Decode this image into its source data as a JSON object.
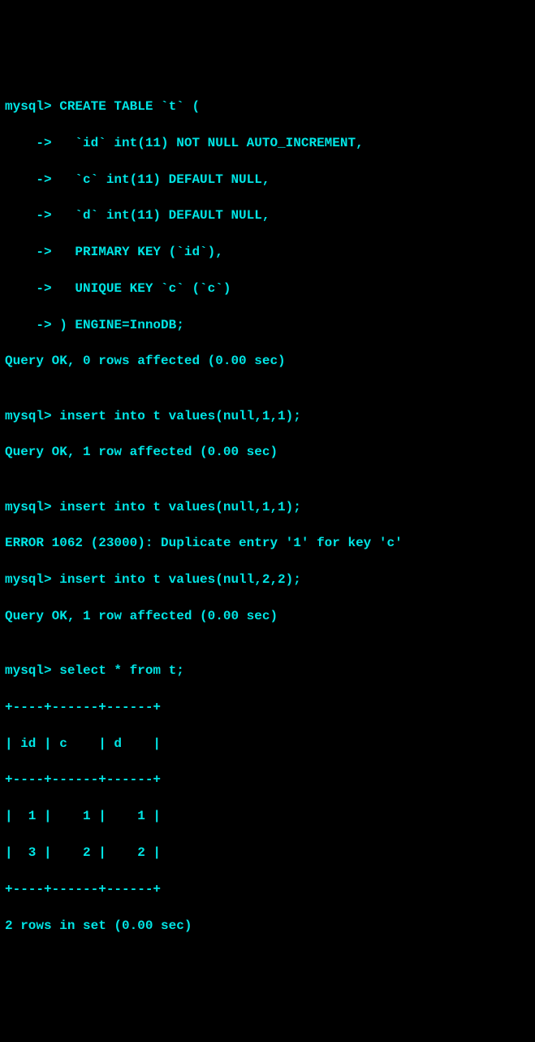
{
  "session": {
    "prompt_main": "mysql>",
    "prompt_cont": "    ->",
    "create_table": {
      "l1": " CREATE TABLE `t` (",
      "l2": "   `id` int(11) NOT NULL AUTO_INCREMENT,",
      "l3": "   `c` int(11) DEFAULT NULL,",
      "l4": "   `d` int(11) DEFAULT NULL,",
      "l5": "   PRIMARY KEY (`id`),",
      "l6": "   UNIQUE KEY `c` (`c`)",
      "l7": " ) ENGINE=InnoDB;"
    },
    "result_create": "Query OK, 0 rows affected (0.00 sec)",
    "blank": "",
    "insert1_cmd": " insert into t values(null,1,1);",
    "result_insert1": "Query OK, 1 row affected (0.00 sec)",
    "insert2_cmd": " insert into t values(null,1,1);",
    "error_dup": "ERROR 1062 (23000): Duplicate entry '1' for key 'c'",
    "insert3_cmd": " insert into t values(null,2,2);",
    "result_insert3": "Query OK, 1 row affected (0.00 sec)",
    "select_cmd": " select * from t;",
    "table": {
      "border": "+----+------+------+",
      "header": "| id | c    | d    |",
      "row1": "|  1 |    1 |    1 |",
      "row2": "|  3 |    2 |    2 |"
    },
    "result_select": "2 rows in set (0.00 sec)"
  }
}
